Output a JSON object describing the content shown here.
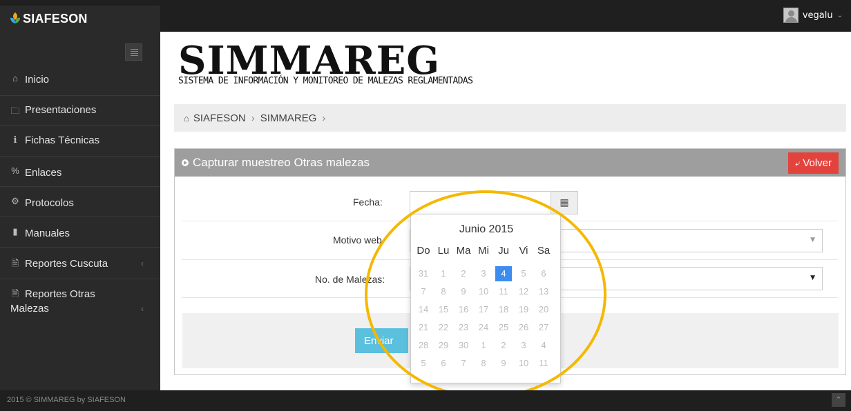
{
  "app": {
    "name": "SIAFESON"
  },
  "user": {
    "name": "vegalu"
  },
  "sidebar": {
    "items": [
      {
        "label": "Inicio",
        "icon": "home-icon"
      },
      {
        "label": "Presentaciones",
        "icon": "folder-icon"
      },
      {
        "label": "Fichas Técnicas",
        "icon": "info-icon"
      },
      {
        "label": "Enlaces",
        "icon": "percent-link-icon"
      },
      {
        "label": "Protocolos",
        "icon": "gear-icon"
      },
      {
        "label": "Manuales",
        "icon": "book-icon"
      },
      {
        "label": "Reportes Cuscuta",
        "icon": "file-icon"
      },
      {
        "label_line1": "Reportes Otras",
        "label_line2": "Malezas",
        "icon": "file-icon"
      }
    ]
  },
  "brand": {
    "title": "SIMMAREG",
    "subtitle": "SISTEMA DE INFORMACIÓN Y MONITOREO DE MALEZAS REGLAMENTADAS"
  },
  "breadcrumb": [
    "SIAFESON",
    "SIMMAREG"
  ],
  "panel": {
    "title": "Capturar muestreo Otras malezas",
    "back_label": "Volver"
  },
  "form": {
    "fecha_label": "Fecha:",
    "fecha_value": "",
    "motivo_label": "Motivo web",
    "motivo_value": "",
    "malezas_label": "No. de Malezas:",
    "malezas_value": "",
    "submit_label": "Enviar"
  },
  "datepicker": {
    "month_label": "Junio 2015",
    "weekdays": [
      "Do",
      "Lu",
      "Ma",
      "Mi",
      "Ju",
      "Vi",
      "Sa"
    ],
    "weeks": [
      [
        "31",
        "1",
        "2",
        "3",
        "4",
        "5",
        "6"
      ],
      [
        "7",
        "8",
        "9",
        "10",
        "11",
        "12",
        "13"
      ],
      [
        "14",
        "15",
        "16",
        "17",
        "18",
        "19",
        "20"
      ],
      [
        "21",
        "22",
        "23",
        "24",
        "25",
        "26",
        "27"
      ],
      [
        "28",
        "29",
        "30",
        "1",
        "2",
        "3",
        "4"
      ],
      [
        "5",
        "6",
        "7",
        "8",
        "9",
        "10",
        "11"
      ]
    ],
    "selected_day": "4"
  },
  "footer": {
    "text": "2015 © SIMMAREG by SIAFESON"
  },
  "colors": {
    "topbar": "#1f1f1f",
    "sidebar": "#2a2a2a",
    "panel_header": "#9e9e9e",
    "danger": "#e2443d",
    "info": "#5bc0de",
    "selected_day": "#3d8cf0",
    "highlight": "#f5b800"
  }
}
